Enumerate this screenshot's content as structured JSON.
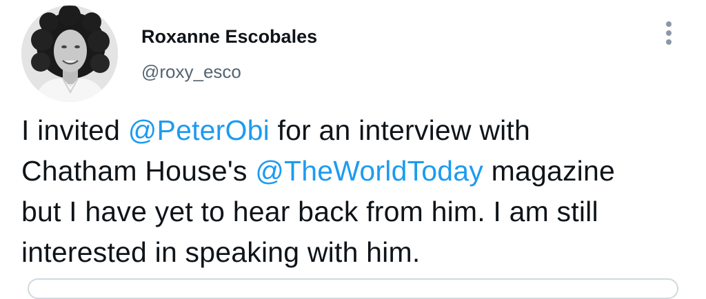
{
  "author": {
    "display_name": "Roxanne Escobales",
    "handle": "@roxy_esco"
  },
  "icons": {
    "more": "more-vertical-icon",
    "avatar": "profile-photo"
  },
  "colors": {
    "link": "#1d9bf0",
    "text": "#0f1419",
    "secondary": "#536471"
  },
  "tweet": {
    "lines": [
      [
        {
          "text": "I invited ",
          "type": "text"
        },
        {
          "text": "@PeterObi",
          "type": "mention"
        },
        {
          "text": " for an interview with",
          "type": "text"
        }
      ],
      [
        {
          "text": "Chatham House's ",
          "type": "text"
        },
        {
          "text": "@TheWorldToday",
          "type": "mention"
        },
        {
          "text": " magazine",
          "type": "text"
        }
      ],
      [
        {
          "text": "but I have yet to hear back from him. I am still",
          "type": "text"
        }
      ],
      [
        {
          "text": "interested in speaking with him.",
          "type": "text"
        }
      ]
    ]
  }
}
